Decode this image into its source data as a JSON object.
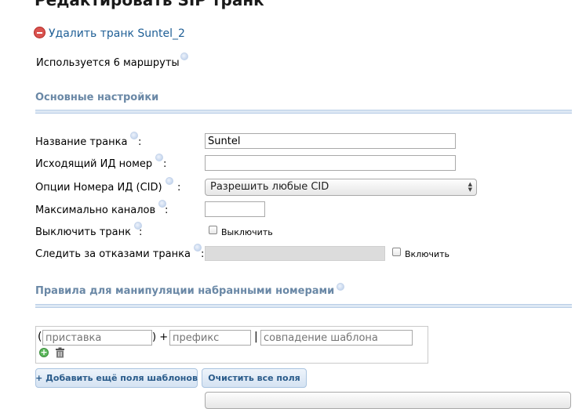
{
  "page": {
    "title": "Редактировать SIP транк"
  },
  "actions": {
    "delete_link": "Удалить транк Suntel_2"
  },
  "usage_text": "Используется 6 маршруты",
  "sections": {
    "general": "Основные настройки",
    "dial_rules": "Правила для манипуляции набранными номерами"
  },
  "fields": {
    "trunk_name": {
      "label": "Название транка",
      "colon": ":",
      "value": "Suntel"
    },
    "outbound_cid": {
      "label": "Исходящий ИД номер",
      "colon": ":",
      "value": ""
    },
    "cid_options": {
      "label": "Опции Номера ИД (CID)",
      "colon": ":",
      "selected": "Разрешить любые CID"
    },
    "max_channels": {
      "label": "Максимально каналов",
      "colon": ":",
      "value": ""
    },
    "disable_trunk": {
      "label": "Выключить транк",
      "colon": ":",
      "checkbox_label": "Выключить",
      "checked": false
    },
    "monitor_failures": {
      "label": "Следить за отказами транка",
      "colon": ":",
      "value": "",
      "checkbox_label": "Включить",
      "checked": false
    }
  },
  "dial_pattern": {
    "open_paren": "(",
    "close_paren_plus": ") +",
    "pipe": "|",
    "prepend_placeholder": "приставка",
    "prefix_placeholder": "префикс",
    "match_placeholder": "совпадение шаблона"
  },
  "buttons": {
    "add_fields": "+ Добавить ещё поля шаблонов",
    "clear_fields": "Очистить все поля"
  },
  "colors": {
    "link": "#1f5f96",
    "section_title": "#6a88a6",
    "button_text": "#2a5b8a",
    "remove_icon": "#d9534f",
    "add_icon": "#5cb85c"
  },
  "icons": {
    "remove": "remove-circle-icon",
    "help": "help-bubble-icon",
    "add": "add-circle-icon",
    "trash": "trash-icon"
  }
}
